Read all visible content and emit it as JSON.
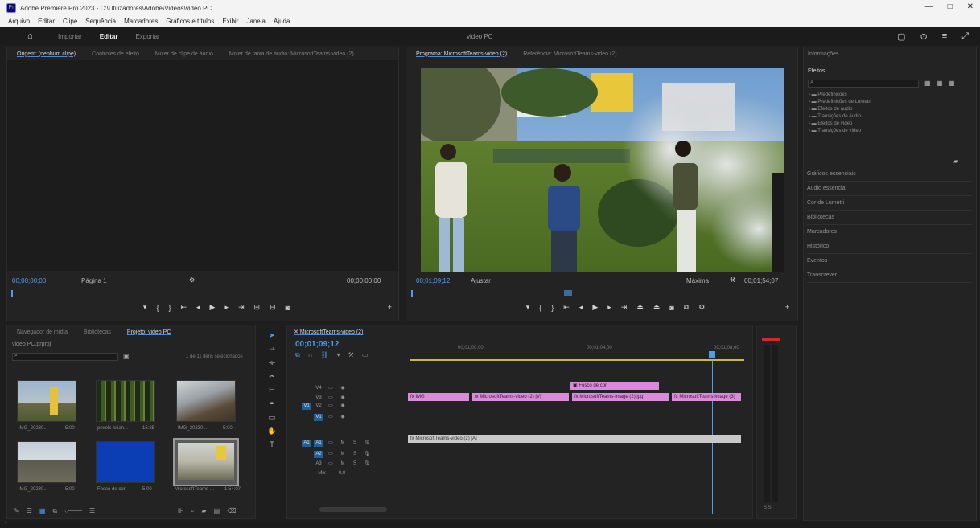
{
  "window": {
    "title": "Adobe Premiere Pro 2023 - C:\\Utilizadores\\Adobe\\Videos\\video PC",
    "app_icon": "Pr",
    "controls": [
      "—",
      "□",
      "✕"
    ]
  },
  "menu": [
    "Arquivo",
    "Editar",
    "Clipe",
    "Sequência",
    "Marcadores",
    "Gráficos e títulos",
    "Exibir",
    "Janela",
    "Ajuda"
  ],
  "workspace": {
    "tabs": [
      "Importar",
      "Editar",
      "Exportar"
    ],
    "active_tab": "Editar",
    "project_name": "video PC"
  },
  "source_monitor": {
    "tabs": [
      "Origem: (nenhum clipe)",
      "Controles de efeito",
      "Mixer de clipe de áudio",
      "Mixer de faixa de áudio: MicrosoftTeams-video (2)"
    ],
    "timecode_left": "00;00;00;00",
    "page_label": "Página 1",
    "timecode_right": "00;00;00;00"
  },
  "program_monitor": {
    "tabs": [
      "Programa: MicrosoftTeams-video (2)",
      "Referência: MicrosoftTeams-video (2)"
    ],
    "timecode": "00;01;09;12",
    "fit": "Ajustar",
    "quality": "Máxima",
    "duration": "00;01;54;07"
  },
  "project_panel": {
    "tabs": [
      "Navegador de mídia",
      "Bibliotecas",
      "Projeto: video PC"
    ],
    "path": "video PC.prproj",
    "items_count": "1 de 11 itens selecionados",
    "items": [
      {
        "name": "IMG_20230...",
        "dur": "5:00"
      },
      {
        "name": "pexels-kilian...",
        "dur": "15:25"
      },
      {
        "name": "IMG_20230...",
        "dur": "5:00"
      },
      {
        "name": "IMG_20230...",
        "dur": "5:00"
      },
      {
        "name": "Fosco de cor",
        "dur": "5:00"
      },
      {
        "name": "MicrosoftTeams-...",
        "dur": "1:54:07"
      }
    ]
  },
  "timeline": {
    "tab": "MicrosoftTeams-video (2)",
    "timecode": "00;01;09;12",
    "ruler": [
      "00;01;00;00",
      "00;01;04;00",
      "00;01;08;00",
      "00;01;12;00"
    ],
    "tracks_video": [
      "V4",
      "V3",
      "V2",
      "V1"
    ],
    "tracks_audio": [
      "A1",
      "A2",
      "A3",
      "Mix"
    ],
    "mix_value": "0,0",
    "clips": {
      "v3": "Fosco de cor",
      "v2_a": "IMG",
      "v2_b": "MicrosoftTeams-video (2) [V]",
      "v2_c": "MicrosoftTeams-image (2).jpg",
      "v2_d": "MicrosoftTeams-image (3)",
      "a1": "MicrosoftTeams-video (2) [A]"
    }
  },
  "right_panel": {
    "title": "Informações",
    "effects_title": "Efeitos",
    "effects_tree": [
      "Predefinições",
      "Predefinições de Lumetri",
      "Efeitos de áudio",
      "Transições de áudio",
      "Efeitos de vídeo",
      "Transições de vídeo"
    ],
    "sections": [
      "Gráficos essenciais",
      "Áudio essencial",
      "Cor de Lumetri",
      "Bibliotecas",
      "Marcadores",
      "Histórico",
      "Eventos",
      "Transcrever"
    ]
  },
  "colors": {
    "accent": "#4b9cf2",
    "clip_pink": "#d98ad8",
    "clip_gray": "#c9c9c9",
    "playhead": "#4b9cf2"
  }
}
